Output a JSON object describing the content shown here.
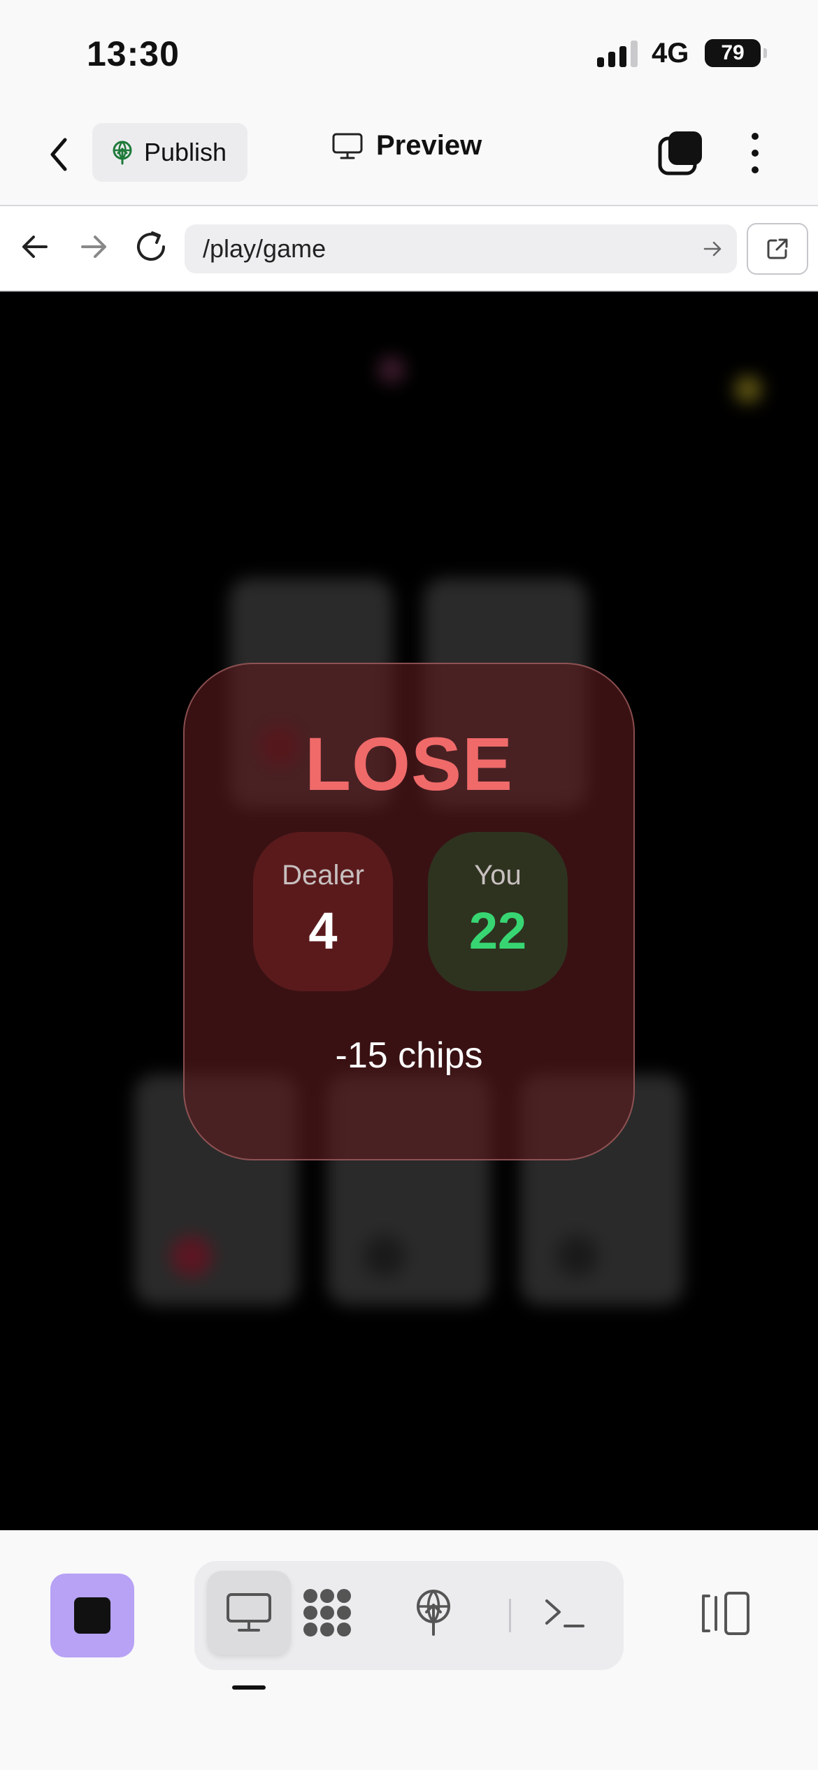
{
  "status_bar": {
    "time": "13:30",
    "network": "4G",
    "battery": "79"
  },
  "header": {
    "publish_label": "Publish",
    "preview_label": "Preview"
  },
  "url_bar": {
    "url": "/play/game"
  },
  "result": {
    "title": "LOSE",
    "dealer_label": "Dealer",
    "dealer_score": "4",
    "player_label": "You",
    "player_score": "22",
    "chips_change": "-15 chips"
  },
  "colors": {
    "lose_title": "#f06a6a",
    "player_score": "#38d672",
    "stop_button": "#b7a2f5"
  },
  "icons": {
    "header": [
      "chevron-left-icon",
      "publish-icon",
      "monitor-icon",
      "tabs-icon",
      "more-vertical-icon"
    ],
    "url_bar": [
      "arrow-left-icon",
      "arrow-right-icon",
      "reload-icon",
      "arrow-right-small-icon",
      "external-link-icon"
    ],
    "toolbar": [
      "stop-icon",
      "monitor-icon",
      "grid-dots-icon",
      "publish-icon",
      "terminal-icon",
      "panel-toggle-icon"
    ]
  }
}
